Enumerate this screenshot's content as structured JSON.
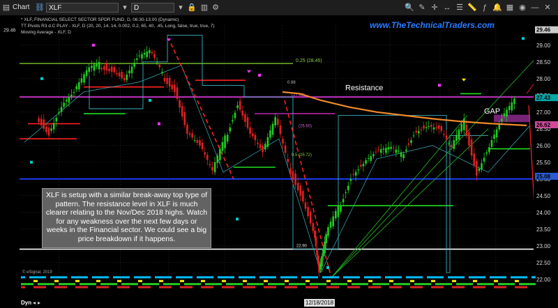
{
  "toolbar": {
    "menu_label": "Chart",
    "symbol": "XLF",
    "interval": "D"
  },
  "header": {
    "line1": "* XLF, FINANCIAL SELECT SECTOR SPDR FUND, D, 06:30-13:00 (Dynamic)",
    "line2": "TT Pivots R3 d.C PLAY - XLF, D (20, 20, 14, 14, 0.002, 0.2, 65, 40, .45, Long, false, true, true, 7)",
    "line3": "Moving Average - XLF, D"
  },
  "watermark": "www.TheTechnicalTraders.com",
  "annotations": {
    "resistance": "Resistance",
    "gap": "GAP",
    "note": "XLF is setup with a similar break-away top type of pattern.  The resistance level in XLF is much clearer relating to the Nov/Dec 2018 highs. Watch for any weakness over the next few days or weeks in the Financial sector.  We could see a big price breakdown if it happens.",
    "copyright": "© eSignal, 2019",
    "pivot_025": "0.25 (28.45)",
    "val_098": "0.98",
    "val_2743": "(27.43)",
    "val_2660": "(26.60)",
    "val_2572": "0.5 (25.72)",
    "val_2290": "22.90"
  },
  "price_tags": [
    {
      "value": "29.46",
      "color": "#cccccc"
    },
    {
      "value": "27.43",
      "color": "#00a8a8"
    },
    {
      "value": "26.62",
      "color": "#d04a9a"
    },
    {
      "value": "25.08",
      "color": "#2a5bd7"
    }
  ],
  "footer": {
    "dyn_label": "Dyn",
    "date_box": "12/18/2018",
    "months": [
      "Aug",
      "Sep",
      "Oct",
      "Nov",
      "Dec",
      "2019",
      "Feb",
      "Mar",
      "Apr"
    ]
  },
  "chart_data": {
    "type": "line",
    "title": "XLF, FINANCIAL SELECT SECTOR SPDR FUND, D",
    "ylim": [
      21.85,
      29.6
    ],
    "y_ticks": [
      22.0,
      22.5,
      23.0,
      23.5,
      24.0,
      24.5,
      25.0,
      25.5,
      26.0,
      26.5,
      27.0,
      27.5,
      28.0,
      28.5,
      29.0
    ],
    "x_tick_labels": [
      "Aug",
      "Sep",
      "Oct",
      "Nov",
      "Dec",
      "2019",
      "Feb",
      "Mar",
      "Apr"
    ],
    "grid": true,
    "series": [
      {
        "name": "XLF",
        "x": [
          "2018-07-20",
          "2018-07-27",
          "2018-08-03",
          "2018-08-10",
          "2018-08-17",
          "2018-08-24",
          "2018-08-31",
          "2018-09-07",
          "2018-09-14",
          "2018-09-21",
          "2018-09-28",
          "2018-10-05",
          "2018-10-12",
          "2018-10-19",
          "2018-10-26",
          "2018-11-02",
          "2018-11-09",
          "2018-11-16",
          "2018-11-23",
          "2018-11-30",
          "2018-12-07",
          "2018-12-14",
          "2018-12-21",
          "2018-12-24",
          "2018-12-28",
          "2019-01-04",
          "2019-01-11",
          "2019-01-18",
          "2019-01-25",
          "2019-02-01",
          "2019-02-08",
          "2019-02-15",
          "2019-02-22",
          "2019-03-01",
          "2019-03-08",
          "2019-03-15",
          "2019-03-22",
          "2019-03-29",
          "2019-04-05",
          "2019-04-12"
        ],
        "values": [
          26.9,
          26.4,
          27.2,
          27.6,
          28.2,
          28.4,
          28.3,
          28.0,
          28.6,
          28.8,
          28.1,
          27.7,
          26.4,
          26.0,
          25.2,
          26.2,
          27.3,
          26.4,
          25.8,
          26.8,
          25.4,
          24.6,
          23.5,
          22.2,
          23.3,
          24.1,
          25.1,
          25.5,
          25.8,
          25.9,
          25.7,
          26.4,
          26.6,
          26.5,
          25.9,
          26.7,
          25.2,
          26.0,
          26.8,
          27.35
        ]
      }
    ],
    "levels": [
      {
        "name": "Resistance",
        "value": 27.45,
        "color": "#cc33cc"
      },
      {
        "name": "Support",
        "value": 25.0,
        "color": "#2040ff"
      },
      {
        "name": "Low",
        "value": 22.9,
        "color": "#ffffff"
      }
    ]
  }
}
